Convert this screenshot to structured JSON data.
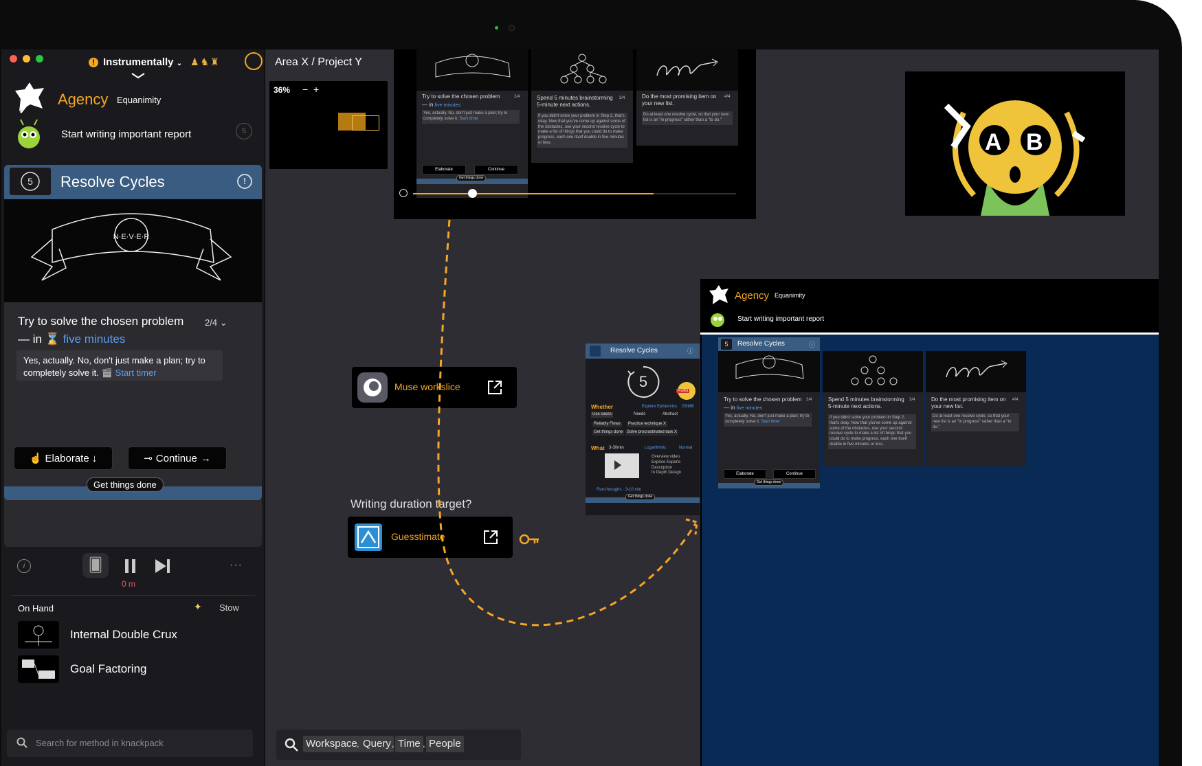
{
  "sidebar": {
    "workspace_name": "Instrumentally",
    "brand": "Agency",
    "brand_sub": "Equanimity",
    "task": "Start writing important report",
    "resolve_title": "Resolve Cycles",
    "problem_line1": "Try to solve the chosen problem",
    "problem_prefix": "— in",
    "problem_link": "five minutes",
    "step": "2/4",
    "note_text": "Yes, actually. No, don't just make a plan; try to completely solve it.",
    "note_link": "Start timer",
    "elaborate": "Elaborate",
    "continue": "Continue",
    "get_things_done": "Get things done",
    "timer": "0 m",
    "on_hand": "On Hand",
    "stow": "Stow",
    "items": [
      {
        "label": "Internal Double Crux"
      },
      {
        "label": "Goal Factoring"
      }
    ],
    "search_placeholder": "Search for method in knackpack"
  },
  "canvas": {
    "breadcrumb": "Area X / Project Y",
    "zoom": "36%",
    "zoom_minus": "−",
    "zoom_plus": "+",
    "slides": [
      {
        "title": "Try to solve the chosen problem",
        "sub": "— in",
        "link": "five minutes",
        "step": "2/4",
        "body": "Yes, actually. No, don't just make a plan; try to completely solve it.",
        "body_link": "Start timer"
      },
      {
        "title": "Spend 5 minutes brainstorming",
        "sub": "5-minute next actions.",
        "step": "3/4",
        "body": "If you didn't solve your problem in Step 2, that's okay. Now that you've come up against some of the obstacles, use your second resolve cycle to make a list of things that you could do to make progress, each one itself doable in five minutes or less."
      },
      {
        "title": "Do the most promising item on",
        "sub": "your new list.",
        "step": "4/4",
        "body": "Do at least one resolve cycle, so that your new list is an \"in progress\" rather than a \"to do.\""
      }
    ],
    "mini_elaborate": "Elaborate",
    "mini_continue": "Continue",
    "mini_gtd": "Get things done",
    "muse_label": "Muse workslice",
    "duration_question": "Writing duration target?",
    "guess_label": "Guesstimate",
    "video_letters": [
      "A",
      "B"
    ],
    "right_brand": "Agency",
    "right_brand_sub": "Equanimity",
    "right_task": "Start writing important report",
    "rc_title": "Resolve Cycles",
    "rc_card": {
      "whether": "Whether",
      "whether_links": [
        "Explore Epistemics",
        "GSMB"
      ],
      "tags_row1": [
        "Use cases",
        "Needs",
        "Abstract"
      ],
      "tags_row2": [
        "Reliably Flows",
        "Practice technique X"
      ],
      "tags_row3": [
        "Get things done",
        "Solve procrastinated task X"
      ],
      "what": "What",
      "what_meta": "3-30min",
      "what_links": [
        "Logarithmic",
        "Normal"
      ],
      "list": [
        "Overview video",
        "Explore Experts",
        "Description",
        "In Depth Design"
      ],
      "footer_link": "Run-throughs · 3-10 min",
      "gtd": "Get things done",
      "badge": "Fruitful"
    },
    "search_chips": [
      "Workspace",
      "Query",
      "Time",
      "People"
    ],
    "search_seps": [
      ",",
      ",",
      ","
    ]
  },
  "colors": {
    "accent_orange": "#f5a623",
    "resolve_blue": "#3a5c80",
    "link_blue": "#5b9ef0",
    "canvas_bg": "#2e2d33",
    "right_panel_bg": "#082a55"
  }
}
